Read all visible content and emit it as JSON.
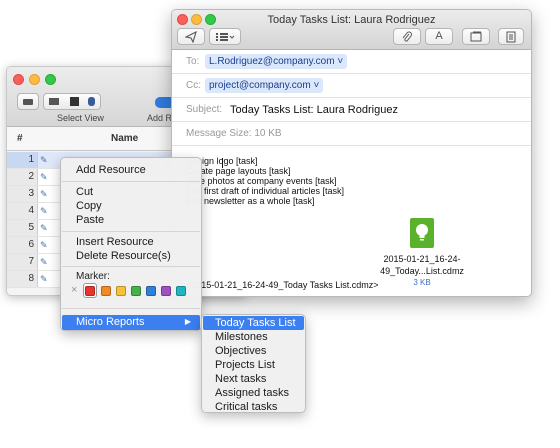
{
  "bg_window": {
    "toolbar_label_select_view": "Select View",
    "toolbar_label_add": "Add R",
    "table_header_hash": "#",
    "table_header_name": "Name",
    "row_numbers": [
      "1",
      "2",
      "3",
      "4",
      "5",
      "6",
      "7",
      "8"
    ]
  },
  "context_menu": {
    "add_resource": "Add Resource",
    "cut": "Cut",
    "copy": "Copy",
    "paste": "Paste",
    "insert_resource": "Insert Resource",
    "delete_resource": "Delete Resource(s)",
    "marker_label": "Marker:",
    "marker_colors": [
      "#e8352c",
      "#f08a24",
      "#f5c23a",
      "#46b04a",
      "#2f80d8",
      "#a04fc0",
      "#1db6c2"
    ],
    "micro_reports": "Micro Reports",
    "submenu_arrow": "▶"
  },
  "submenu": {
    "items": [
      "Today Tasks List",
      "Milestones",
      "Objectives",
      "Projects List",
      "Next tasks",
      "Assigned tasks",
      "Critical tasks"
    ]
  },
  "mail": {
    "window_title": "Today Tasks List: Laura Rodriguez",
    "font_button_label": "A",
    "to_label": "To:",
    "to_value": "L.Rodriguez@company.com",
    "cc_label": "Cc:",
    "cc_value": "project@company.com",
    "subject_label": "Subject:",
    "subject_value": "Today Tasks List: Laura Rodriguez",
    "size_label": "Message Size:  10 KB",
    "body_lines": [
      "Design logo  [task]",
      "Create page layouts  [task]",
      "Take photos at company events  [task]",
      "Edit first draft of individual articles  [task]",
      "Edit newsletter as a whole  [task]"
    ],
    "attachment_name_line1": "2015-01-21_16-24-",
    "attachment_name_line2": "49_Today...List.cdmz",
    "attachment_size": "3 KB",
    "attachment_ref": "<2015-01-21_16-24-49_Today Tasks List.cdmz>",
    "dropdown_caret": "˅"
  }
}
